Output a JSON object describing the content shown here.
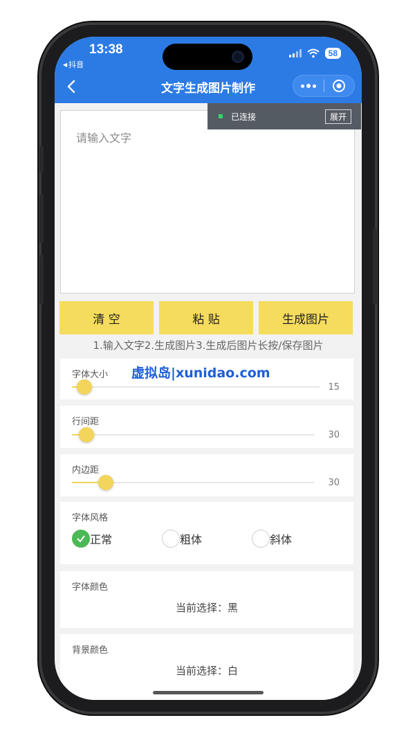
{
  "status_bar": {
    "time": "13:38",
    "back_app": "抖音",
    "battery": "58"
  },
  "nav": {
    "title": "文字生成图片制作"
  },
  "connection": {
    "status": "已连接",
    "expand_label": "展开"
  },
  "editor": {
    "placeholder": "请输入文字"
  },
  "buttons": {
    "clear": "清 空",
    "paste": "粘 贴",
    "generate": "生成图片"
  },
  "instructions": "1.输入文字2.生成图片3.生成后图片长按/保存图片",
  "watermark": "虚拟岛|xunidao.com",
  "sliders": [
    {
      "label": "字体大小",
      "value": "15",
      "level": 0.05
    },
    {
      "label": "行间距",
      "value": "30",
      "level": 0.06
    },
    {
      "label": "内边距",
      "value": "30",
      "level": 0.14
    }
  ],
  "font_style": {
    "label": "字体风格",
    "options": [
      "正常",
      "粗体",
      "斜体"
    ],
    "selected": "正常"
  },
  "font_color": {
    "label": "字体颜色",
    "current": "当前选择：黑"
  },
  "bg_color": {
    "label": "背景颜色",
    "current": "当前选择：白"
  },
  "colors": {
    "nav_blue": "#2c7be5",
    "button_yellow": "#f6dc5d",
    "check_green": "#4cb856"
  }
}
